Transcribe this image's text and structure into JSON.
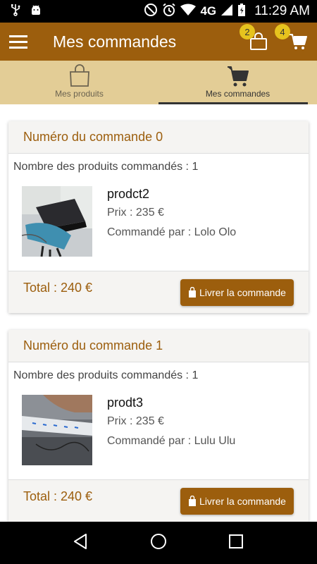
{
  "status_bar": {
    "time": "11:29 AM",
    "network": "4G"
  },
  "app_bar": {
    "title": "Mes commandes",
    "bag_badge": "2",
    "cart_badge": "4"
  },
  "tabs": [
    {
      "label": "Mes produits",
      "icon": "shopping-bag-icon",
      "active": false
    },
    {
      "label": "Mes commandes",
      "icon": "cart-icon",
      "active": true
    }
  ],
  "orders": [
    {
      "title": "Numéro du commande 0",
      "count_text": "Nombre des produits commandés : 1",
      "product_name": "prodct2",
      "price": "Prix : 235 €",
      "buyer": "Commandé par : Lolo Olo",
      "total": "Total : 240 €",
      "button": "Livrer la commande"
    },
    {
      "title": "Numéro du commande 1",
      "count_text": "Nombre des produits commandés : 1",
      "product_name": "prodt3",
      "price": "Prix : 235 €",
      "buyer": "Commandé par : Lulu Ulu",
      "total": "Total : 240 €",
      "button": "Livrer la commande"
    }
  ],
  "colors": {
    "primary": "#9c5e0d",
    "tab_bg": "#e3cd96",
    "badge": "#e6c31e"
  }
}
